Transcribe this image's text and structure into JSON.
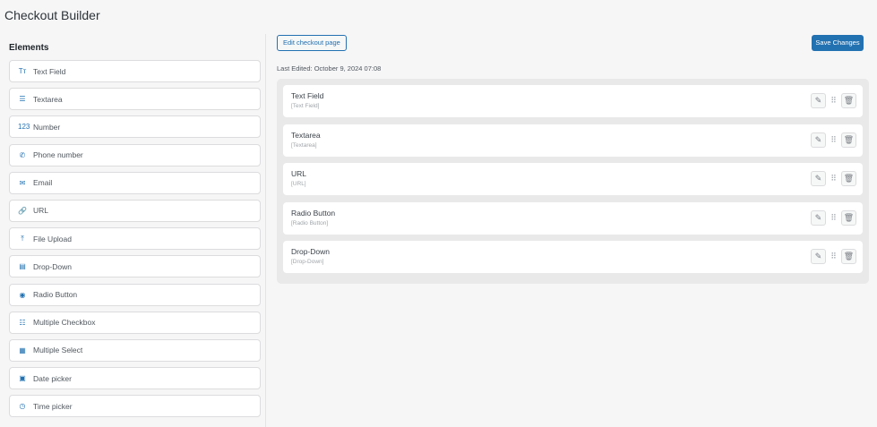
{
  "title": "Checkout Builder",
  "elements": {
    "heading": "Elements",
    "items": [
      {
        "label": "Text Field",
        "icon": "Tт"
      },
      {
        "label": "Textarea",
        "icon": "☰"
      },
      {
        "label": "Number",
        "icon": "123"
      },
      {
        "label": "Phone number",
        "icon": "✆"
      },
      {
        "label": "Email",
        "icon": "✉"
      },
      {
        "label": "URL",
        "icon": "🔗"
      },
      {
        "label": "File Upload",
        "icon": "⤒"
      },
      {
        "label": "Drop-Down",
        "icon": "▤"
      },
      {
        "label": "Radio Button",
        "icon": "◉"
      },
      {
        "label": "Multiple Checkbox",
        "icon": "☷"
      },
      {
        "label": "Multiple Select",
        "icon": "▦"
      },
      {
        "label": "Date picker",
        "icon": "▣"
      },
      {
        "label": "Time picker",
        "icon": "◷"
      }
    ]
  },
  "toolbar": {
    "edit_label": "Edit checkout page",
    "save_label": "Save Changes",
    "last_edited": "Last Edited: October 9, 2024 07:08"
  },
  "fields": [
    {
      "name": "Text Field",
      "sub": "[Text Field]"
    },
    {
      "name": "Textarea",
      "sub": "[Textarea]"
    },
    {
      "name": "URL",
      "sub": "[URL]"
    },
    {
      "name": "Radio Button",
      "sub": "[Radio Button]"
    },
    {
      "name": "Drop-Down",
      "sub": "[Drop-Down]"
    }
  ],
  "icons": {
    "edit": "✎",
    "drag": "⠿",
    "delete": "🗑"
  }
}
